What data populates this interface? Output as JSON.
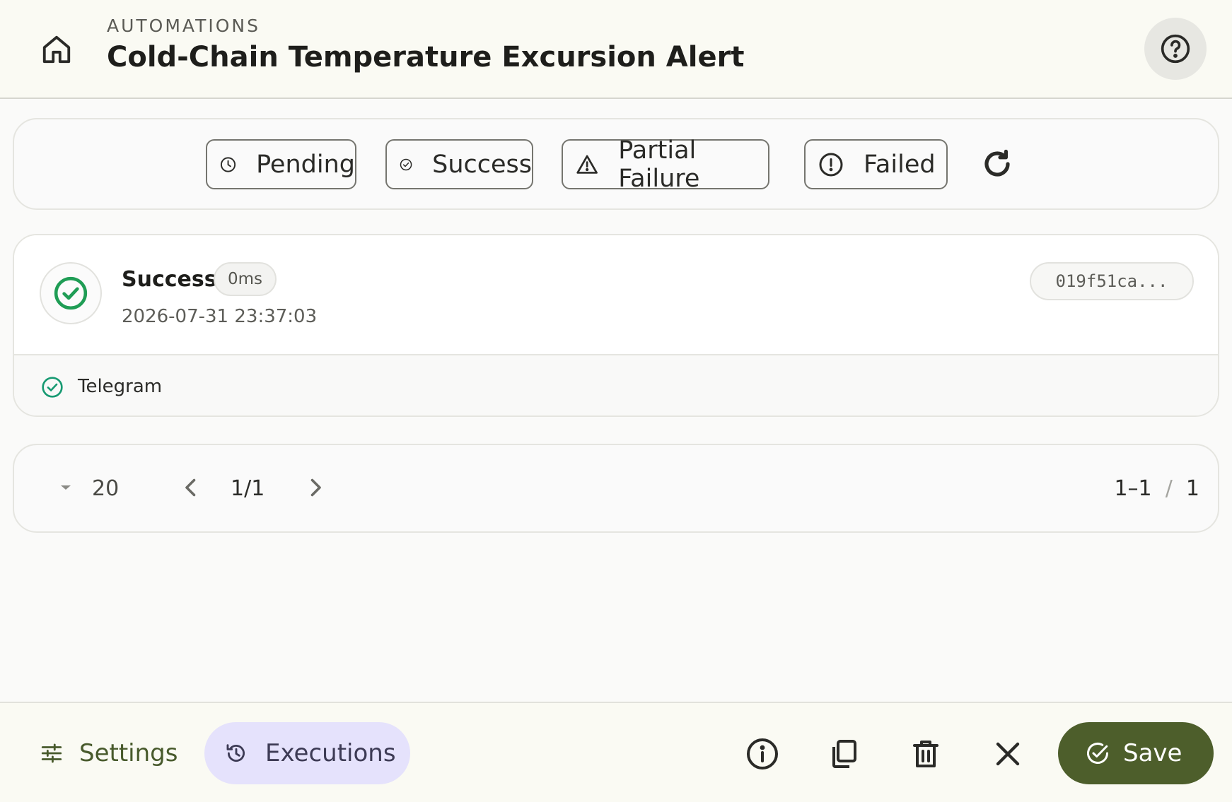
{
  "header": {
    "eyebrow": "AUTOMATIONS",
    "title": "Cold-Chain Temperature Excursion Alert",
    "home_icon": "home-icon",
    "help_icon": "help-icon"
  },
  "filters": {
    "chips": [
      {
        "label": "Pending",
        "icon": "clock-icon"
      },
      {
        "label": "Success",
        "icon": "check-circle-icon"
      },
      {
        "label": "Partial Failure",
        "icon": "warning-triangle-icon"
      },
      {
        "label": "Failed",
        "icon": "alert-circle-icon"
      }
    ],
    "refresh_icon": "refresh-icon"
  },
  "execution": {
    "status": "Success",
    "duration": "0ms",
    "timestamp": "2026-07-31 23:37:03",
    "id": "019f51ca...",
    "status_color": "#1f9d55",
    "channels": [
      {
        "label": "Telegram",
        "status": "success"
      }
    ]
  },
  "pagination": {
    "page_size": "20",
    "page": "1/1",
    "range": "1–1",
    "separator": "/",
    "total": "1"
  },
  "bottom_bar": {
    "settings_label": "Settings",
    "executions_label": "Executions",
    "save_label": "Save",
    "accent_color": "#4d5e2b",
    "active_tab_color": "#e5e2fc"
  }
}
